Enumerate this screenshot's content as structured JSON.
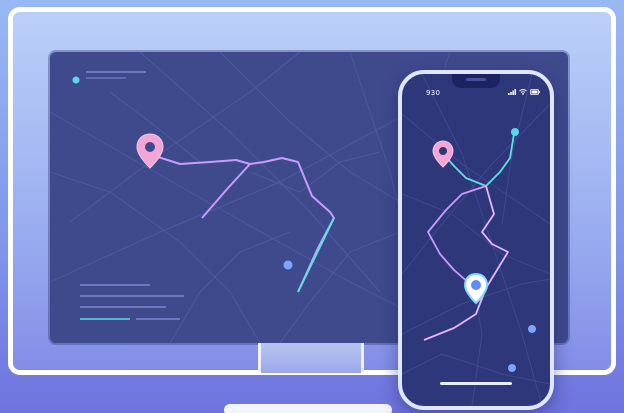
{
  "phone": {
    "status_time": "930",
    "status_icons": [
      "signal-icon",
      "wifi-icon",
      "battery-icon"
    ]
  },
  "colors": {
    "background_top": "#98b8f4",
    "background_bottom": "#6f73de",
    "screen": "#3f4a8d",
    "phone_screen": "#2e377a",
    "pin_pink": "#f2a6d6",
    "pin_blue": "#ffffff",
    "route_purple": "#c79cff",
    "route_cyan": "#5fe0e0",
    "dot_cyan": "#58d8e8",
    "dot_blue": "#7fa6ff"
  }
}
